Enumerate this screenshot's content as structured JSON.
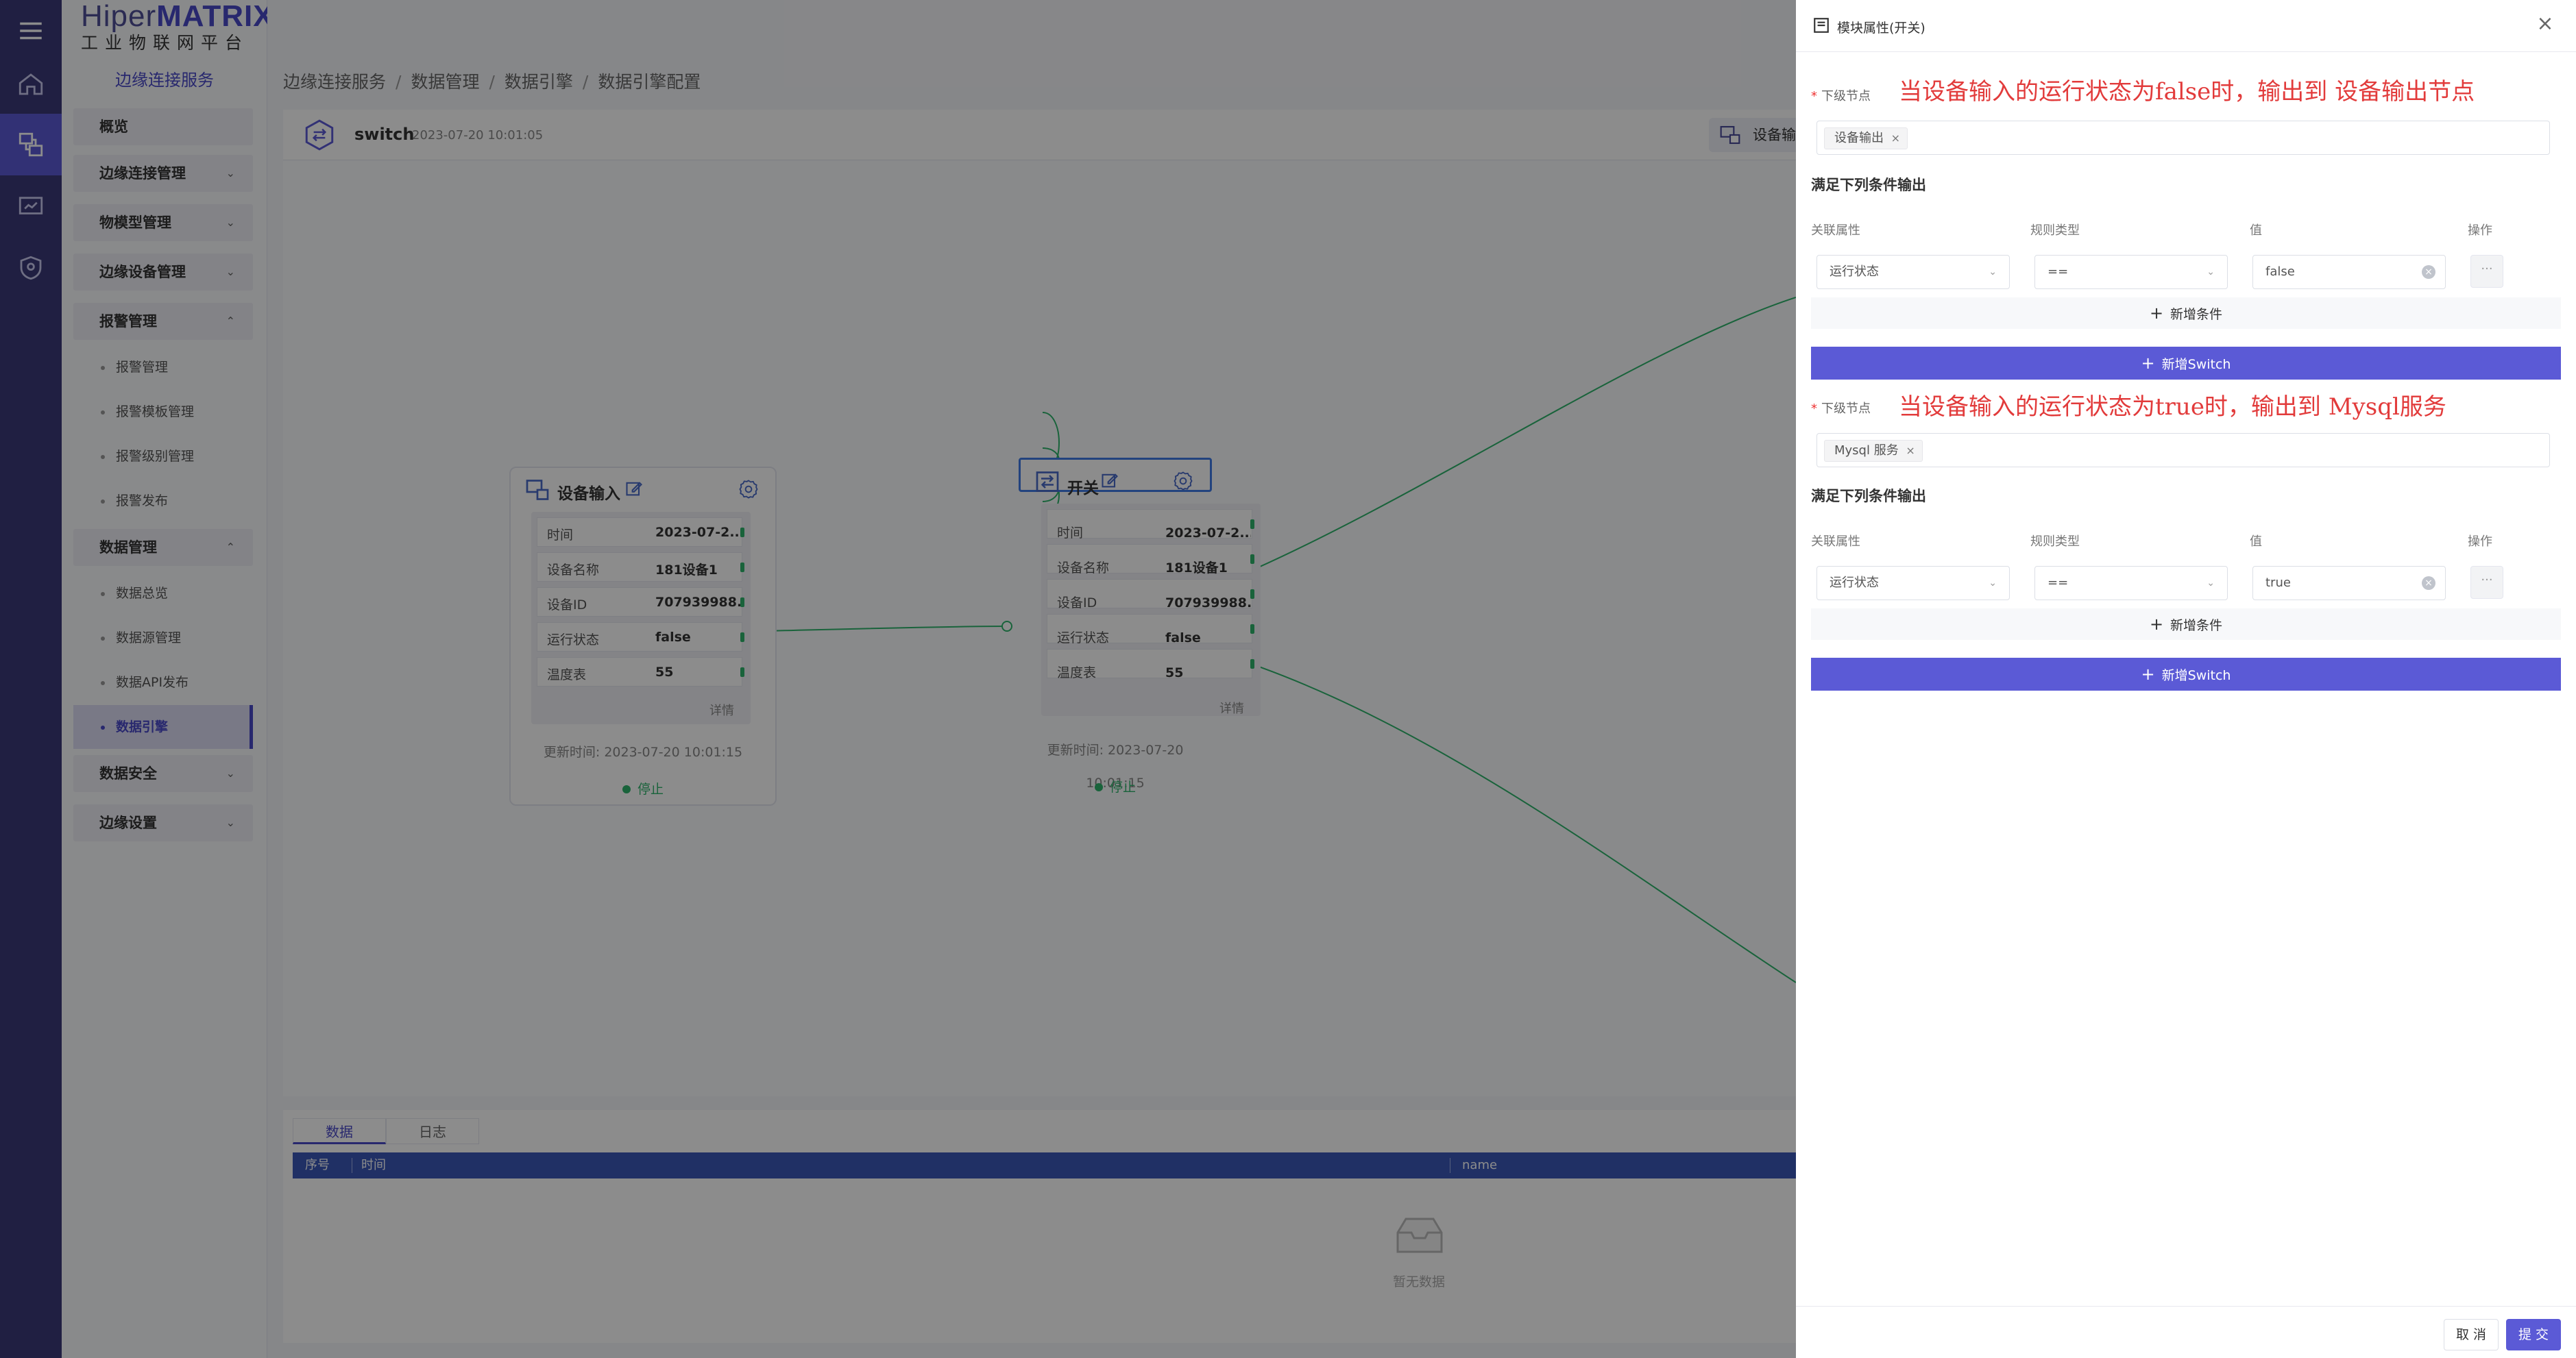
{
  "logo": {
    "brand_left": "Hiper",
    "brand_right": "MATRIX",
    "subtitle": "工业物联网平台"
  },
  "menu": {
    "section_title": "边缘连接服务",
    "items": [
      {
        "label": "概览"
      },
      {
        "label": "边缘连接管理"
      },
      {
        "label": "物模型管理"
      },
      {
        "label": "边缘设备管理"
      },
      {
        "label": "报警管理"
      },
      {
        "label": "数据管理"
      },
      {
        "label": "数据安全"
      },
      {
        "label": "边缘设置"
      }
    ],
    "alarm_sub": [
      {
        "label": "报警管理"
      },
      {
        "label": "报警模板管理"
      },
      {
        "label": "报警级别管理"
      },
      {
        "label": "报警发布"
      }
    ],
    "data_sub": [
      {
        "label": "数据总览"
      },
      {
        "label": "数据源管理"
      },
      {
        "label": "数据API发布"
      },
      {
        "label": "数据引擎"
      }
    ]
  },
  "breadcrumb": [
    "边缘连接服务",
    "数据管理",
    "数据引擎",
    "数据引擎配置"
  ],
  "topbar": {
    "title": "switch",
    "time": "2023-07-20 10:01:05",
    "device_input_btn": "设备输入"
  },
  "nodes": {
    "input": {
      "title": "设备输入",
      "rows": [
        {
          "k": "时间",
          "v": "2023-07-2..."
        },
        {
          "k": "设备名称",
          "v": "181设备1"
        },
        {
          "k": "设备ID",
          "v": "707939988..."
        },
        {
          "k": "运行状态",
          "v": "false"
        },
        {
          "k": "温度表",
          "v": "55"
        }
      ],
      "detail": "详情",
      "update": "更新时间:  2023-07-20 10:01:15",
      "status": "停止"
    },
    "switch": {
      "title": "开关",
      "rows": [
        {
          "k": "时间",
          "v": "2023-07-2..."
        },
        {
          "k": "设备名称",
          "v": "181设备1"
        },
        {
          "k": "设备ID",
          "v": "707939988..."
        },
        {
          "k": "运行状态",
          "v": "false"
        },
        {
          "k": "温度表",
          "v": "55"
        }
      ],
      "detail": "详情",
      "update": "更新时间:  2023-07-20 10:01:15",
      "status": "停止"
    }
  },
  "bottom": {
    "tabs": [
      "数据",
      "日志"
    ],
    "columns": [
      "序号",
      "时间",
      "name"
    ],
    "empty": "暂无数据"
  },
  "drawer": {
    "title": "模块属性(开关)",
    "next_node_label": "下级节点",
    "cond_title": "满足下列条件输出",
    "col_headers": [
      "关联属性",
      "规则类型",
      "值",
      "操作"
    ],
    "add_condition": "新增条件",
    "add_switch": "新增Switch",
    "op_btn": "···",
    "blocks": [
      {
        "note": "当设备输入的运行状态为false时，输出到 设备输出节点",
        "tag": "设备输出",
        "attr": "运行状态",
        "rule": "==",
        "value": "false"
      },
      {
        "note": "当设备输入的运行状态为true时，输出到 Mysql服务",
        "tag": "Mysql 服务",
        "attr": "运行状态",
        "rule": "==",
        "value": "true"
      }
    ],
    "cancel": "取 消",
    "submit": "提 交"
  },
  "colors": {
    "accent": "#5b5ad6",
    "rail": "#3b3a78",
    "note_red": "#e23b3b",
    "status_green": "#2fb56c",
    "table_header": "#3b58b8"
  }
}
